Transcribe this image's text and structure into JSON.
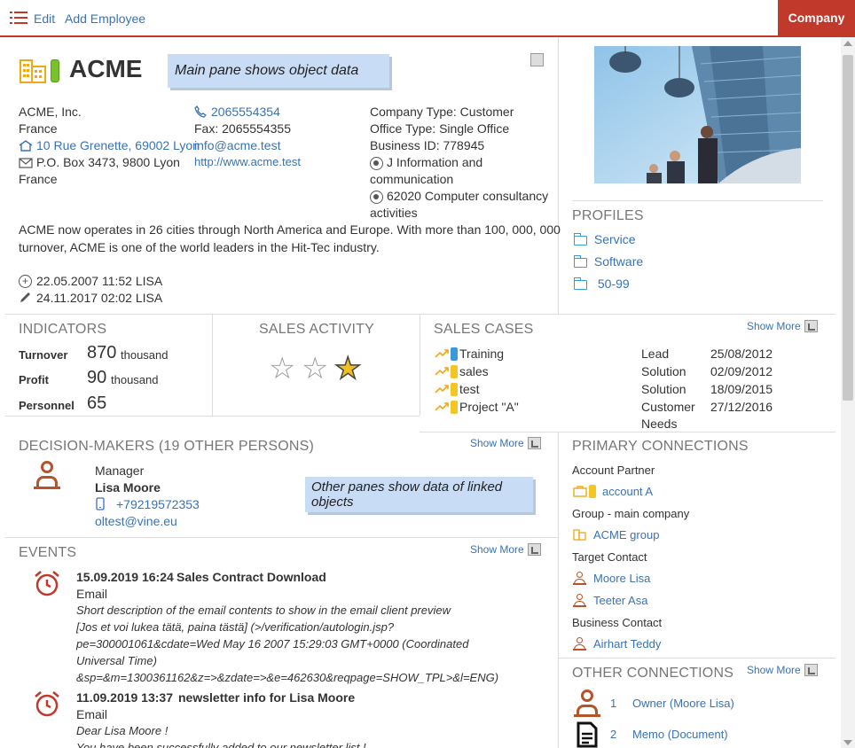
{
  "toolbar": {
    "edit": "Edit",
    "add_employee": "Add Employee",
    "company_tab": "Company"
  },
  "header": {
    "title": "ACME",
    "note_main": "Main pane shows object data"
  },
  "address": {
    "line1": "ACME, Inc.",
    "line2": "France",
    "street": "10 Rue Grenette, 69002 Lyon",
    "pobox": "P.O. Box 3473, 9800 Lyon",
    "country": "France"
  },
  "contact": {
    "phone": "2065554354",
    "fax": "Fax: 2065554355",
    "email": "info@acme.test",
    "web": "http://www.acme.test"
  },
  "info": {
    "type": "Company Type: Customer",
    "office": "Office Type: Single Office",
    "business_id": "Business ID: 778945",
    "industry1_a": "J Information and",
    "industry1_b": "communication",
    "industry2_a": "62020 Computer consultancy",
    "industry2_b": "activities"
  },
  "description": {
    "line1": "ACME now operates in 26 cities through North America and Europe. With more than 100, 000, 000",
    "line2": "turnover, ACME is one of the world leaders in the Hit-Tec industry."
  },
  "audit": {
    "created": "22.05.2007 11:52 LISA",
    "modified": "24.11.2017 02:02 LISA"
  },
  "profiles": {
    "title": "PROFILES",
    "items": [
      "Service",
      "Software",
      "50-99"
    ]
  },
  "indicators": {
    "title": "INDICATORS",
    "rows": [
      {
        "label": "Turnover",
        "value": "870",
        "unit": "thousand"
      },
      {
        "label": "Profit",
        "value": "90",
        "unit": "thousand"
      },
      {
        "label": "Personnel",
        "value": "65",
        "unit": ""
      }
    ]
  },
  "sales_activity": {
    "title": "SALES ACTIVITY",
    "stars": [
      "☆",
      "☆",
      "★"
    ]
  },
  "sales_cases": {
    "title": "SALES CASES",
    "show_more": "Show More",
    "items": [
      {
        "name": "Training",
        "status": "Lead",
        "date": "25/08/2012"
      },
      {
        "name": "sales",
        "status": "Solution",
        "date": "02/09/2012"
      },
      {
        "name": "test",
        "status": "Solution",
        "date": "18/09/2015"
      },
      {
        "name": "Project \"A\"",
        "status": "Customer",
        "status2": "Needs",
        "date": "27/12/2016"
      }
    ]
  },
  "decision_makers": {
    "title": "DECISION-MAKERS (19 OTHER PERSONS)",
    "show_more": "Show More",
    "role": "Manager",
    "name": "Lisa Moore",
    "phone": "+79219572353",
    "email": "oltest@vine.eu",
    "note": "Other panes show data  of linked objects"
  },
  "events": {
    "title": "EVENTS",
    "show_more": "Show More",
    "items": [
      {
        "datetime": "15.09.2019 16:24",
        "subject": "Sales Contract Download",
        "type": "Email",
        "lines": [
          "Short description of the email contents to show in the email client preview",
          "[Jos et voi lukea tätä, paina tästä] (>/verification/autologin.jsp?",
          "pe=300001061&cdate=Wed May 16 2007 15:29:03 GMT+0000 (Coordinated",
          "Universal Time)",
          "&sp=&m=1300361162&z=>&zdate=>&e=462630&reqpage=SHOW_TPL>&l=ENG)"
        ]
      },
      {
        "datetime": "11.09.2019 13:37",
        "subject": "newsletter info for Lisa Moore",
        "type": "Email",
        "lines": [
          "Dear Lisa Moore !",
          "You have been successfully added to our newsletter list !"
        ]
      }
    ]
  },
  "primary_connections": {
    "title": "PRIMARY CONNECTIONS",
    "account_partner_label": "Account Partner",
    "account_partner": "account A",
    "group_label": "Group - main company",
    "group": "ACME group",
    "target_label": "Target Contact",
    "target1": "Moore Lisa",
    "target2": "Teeter Asa",
    "business_label": "Business Contact",
    "business": "Airhart Teddy"
  },
  "other_connections": {
    "title": "OTHER CONNECTIONS",
    "show_more": "Show More",
    "items": [
      {
        "num": "1",
        "label": "Owner (Moore Lisa)"
      },
      {
        "num": "2",
        "label": "Memo (Document)"
      }
    ]
  },
  "colors": {
    "accent": "#c0392b",
    "link": "#3a72b3",
    "person": "#b5532a"
  }
}
